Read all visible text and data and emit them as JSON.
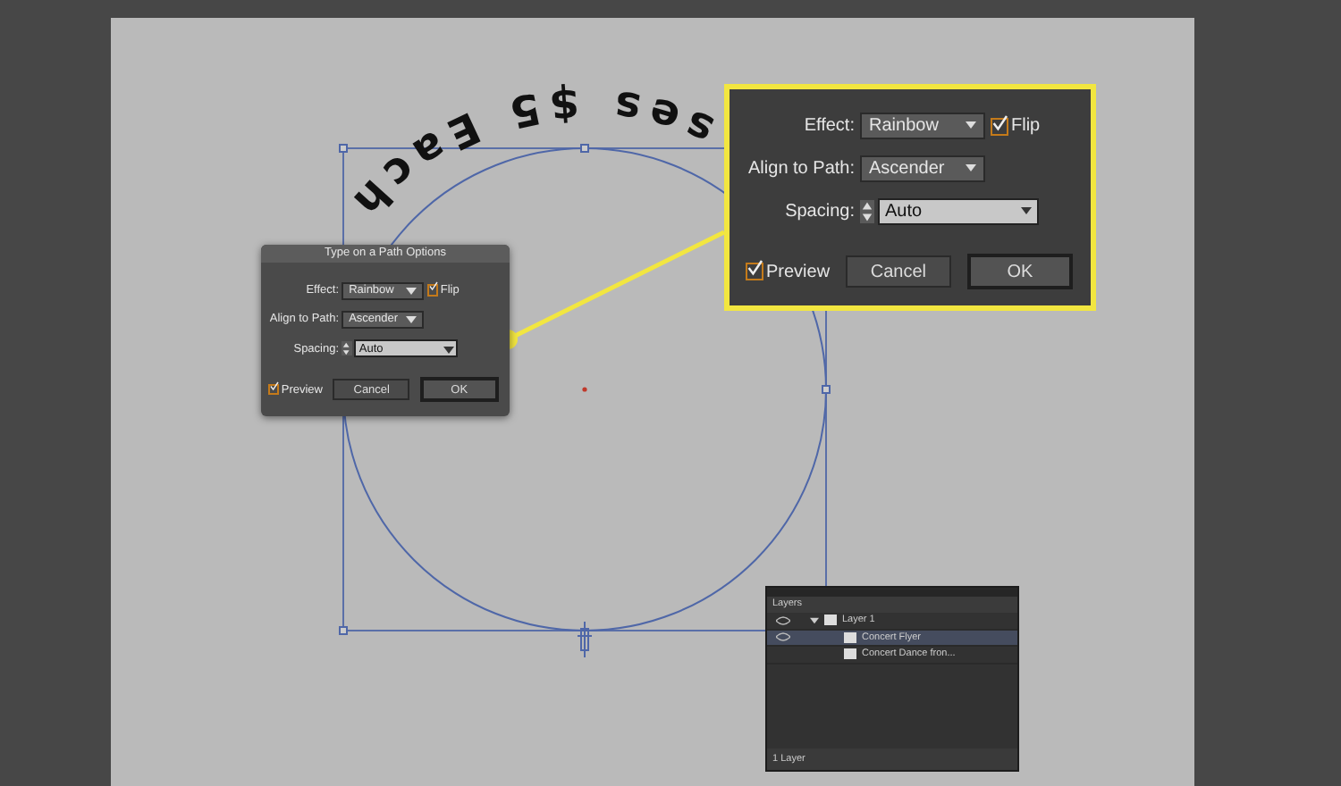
{
  "artwork": {
    "text_on_path": "ses $5 Each"
  },
  "dialog": {
    "title": "Type on a Path Options",
    "effect_label": "Effect:",
    "effect": "Rainbow",
    "flip": {
      "label": "Flip",
      "checked": true
    },
    "align_label": "Align to Path:",
    "align": "Ascender",
    "spacing_label": "Spacing:",
    "spacing": "Auto",
    "preview": {
      "label": "Preview",
      "checked": true
    },
    "buttons": [
      {
        "label": "Cancel",
        "default": false
      },
      {
        "label": "OK",
        "default": true
      }
    ]
  },
  "callout": {
    "effect_label": "Effect:",
    "effect": "Rainbow",
    "flip": {
      "label": "Flip",
      "checked": true
    },
    "align_label": "Align to Path:",
    "align": "Ascender",
    "spacing_label": "Spacing:",
    "spacing": "Auto",
    "preview": {
      "label": "Preview",
      "checked": true
    },
    "buttons": [
      {
        "label": "Cancel",
        "default": false
      },
      {
        "label": "OK",
        "default": true
      }
    ]
  },
  "layers_panel": {
    "title": "Layers",
    "rows": [
      {
        "name": "Layer 1",
        "expanded": true,
        "visible": true,
        "selected": false,
        "children": [
          {
            "name": "Concert Flyer",
            "visible": true,
            "selected": true
          },
          {
            "name": "Concert Dance fron...",
            "visible": false,
            "selected": false
          }
        ]
      }
    ],
    "footer": "1 Layer"
  }
}
